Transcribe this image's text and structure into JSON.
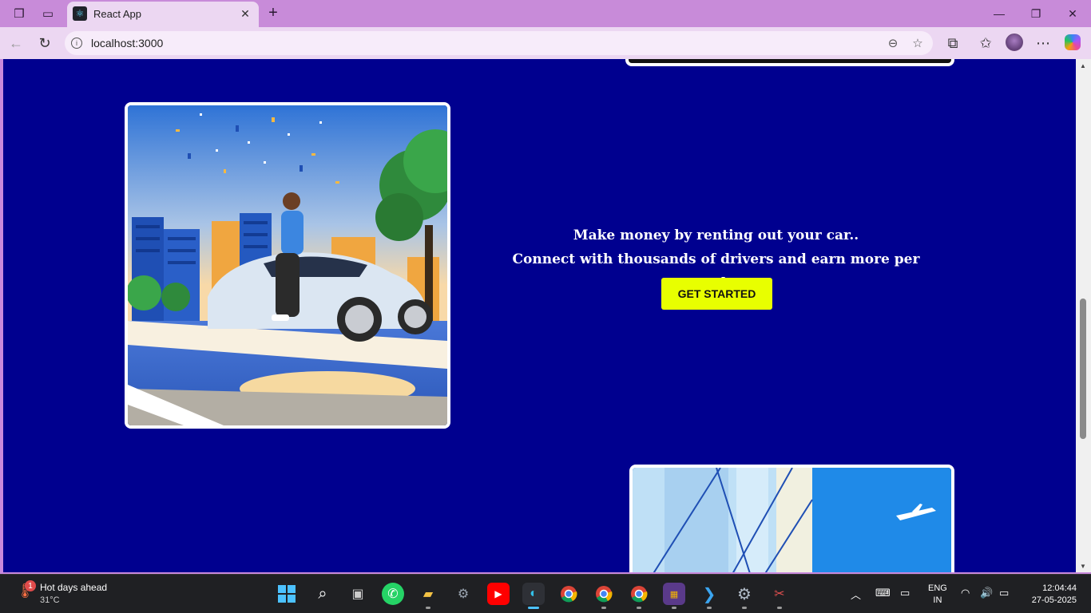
{
  "browser": {
    "tab_title": "React App",
    "url": "localhost:3000"
  },
  "page": {
    "hero_line1": "Make money by renting out your car..",
    "hero_line2": "Connect with thousands of drivers and earn more per week..",
    "cta_label": "GET STARTED"
  },
  "taskbar": {
    "weather_title": "Hot days ahead",
    "weather_temp": "31°C",
    "weather_badge": "1",
    "lang_line1": "ENG",
    "lang_line2": "IN",
    "time": "12:04:44",
    "date": "27-05-2025"
  },
  "colors": {
    "page_background": "#00008f",
    "cta_background": "#e8ff00",
    "browser_frame": "#c889dc"
  }
}
